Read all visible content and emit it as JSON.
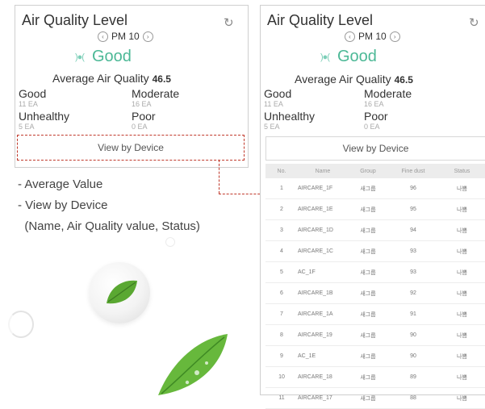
{
  "left_panel": {
    "title": "Air Quality Level",
    "pm_label": "PM 10",
    "status": "Good",
    "average_label": "Average Air Quality",
    "average_value": "46.5",
    "stats": [
      {
        "label": "Good",
        "count": "11 EA"
      },
      {
        "label": "Moderate",
        "count": "16 EA"
      },
      {
        "label": "Unhealthy",
        "count": "5 EA"
      },
      {
        "label": "Poor",
        "count": "0 EA"
      }
    ],
    "view_button": "View by Device"
  },
  "right_panel": {
    "title": "Air Quality Level",
    "pm_label": "PM 10",
    "status": "Good",
    "average_label": "Average Air Quality",
    "average_value": "46.5",
    "stats": [
      {
        "label": "Good",
        "count": "11 EA"
      },
      {
        "label": "Moderate",
        "count": "16 EA"
      },
      {
        "label": "Unhealthy",
        "count": "5 EA"
      },
      {
        "label": "Poor",
        "count": "0 EA"
      }
    ],
    "view_button": "View by Device",
    "table": {
      "headers": [
        "No.",
        "Name",
        "Group",
        "Fine dust",
        "Status"
      ],
      "rows": [
        [
          "1",
          "AIRCARE_1F",
          "새그룹",
          "96",
          "나쁨"
        ],
        [
          "2",
          "AIRCARE_1E",
          "새그룹",
          "95",
          "나쁨"
        ],
        [
          "3",
          "AIRCARE_1D",
          "새그룹",
          "94",
          "나쁨"
        ],
        [
          "4",
          "AIRCARE_1C",
          "새그룹",
          "93",
          "나쁨"
        ],
        [
          "5",
          "AC_1F",
          "새그룹",
          "93",
          "나쁨"
        ],
        [
          "6",
          "AIRCARE_1B",
          "새그룹",
          "92",
          "나쁨"
        ],
        [
          "7",
          "AIRCARE_1A",
          "새그룹",
          "91",
          "나쁨"
        ],
        [
          "8",
          "AIRCARE_19",
          "새그룹",
          "90",
          "나쁨"
        ],
        [
          "9",
          "AC_1E",
          "새그룹",
          "90",
          "나쁨"
        ],
        [
          "10",
          "AIRCARE_18",
          "새그룹",
          "89",
          "나쁨"
        ],
        [
          "11",
          "AIRCARE_17",
          "새그룹",
          "88",
          "나쁨"
        ]
      ]
    }
  },
  "notes": [
    "- Average Value",
    "- View by Device",
    "  (Name, Air Quality value, Status)"
  ],
  "colors": {
    "good": "#4cb896",
    "accent_dashed": "#c0392b",
    "leaf": "#5aa832"
  },
  "icons": {
    "refresh": "refresh-icon",
    "prev": "chevron-left-circle-icon",
    "next": "chevron-right-circle-icon",
    "air_quality": "air-wave-icon"
  }
}
